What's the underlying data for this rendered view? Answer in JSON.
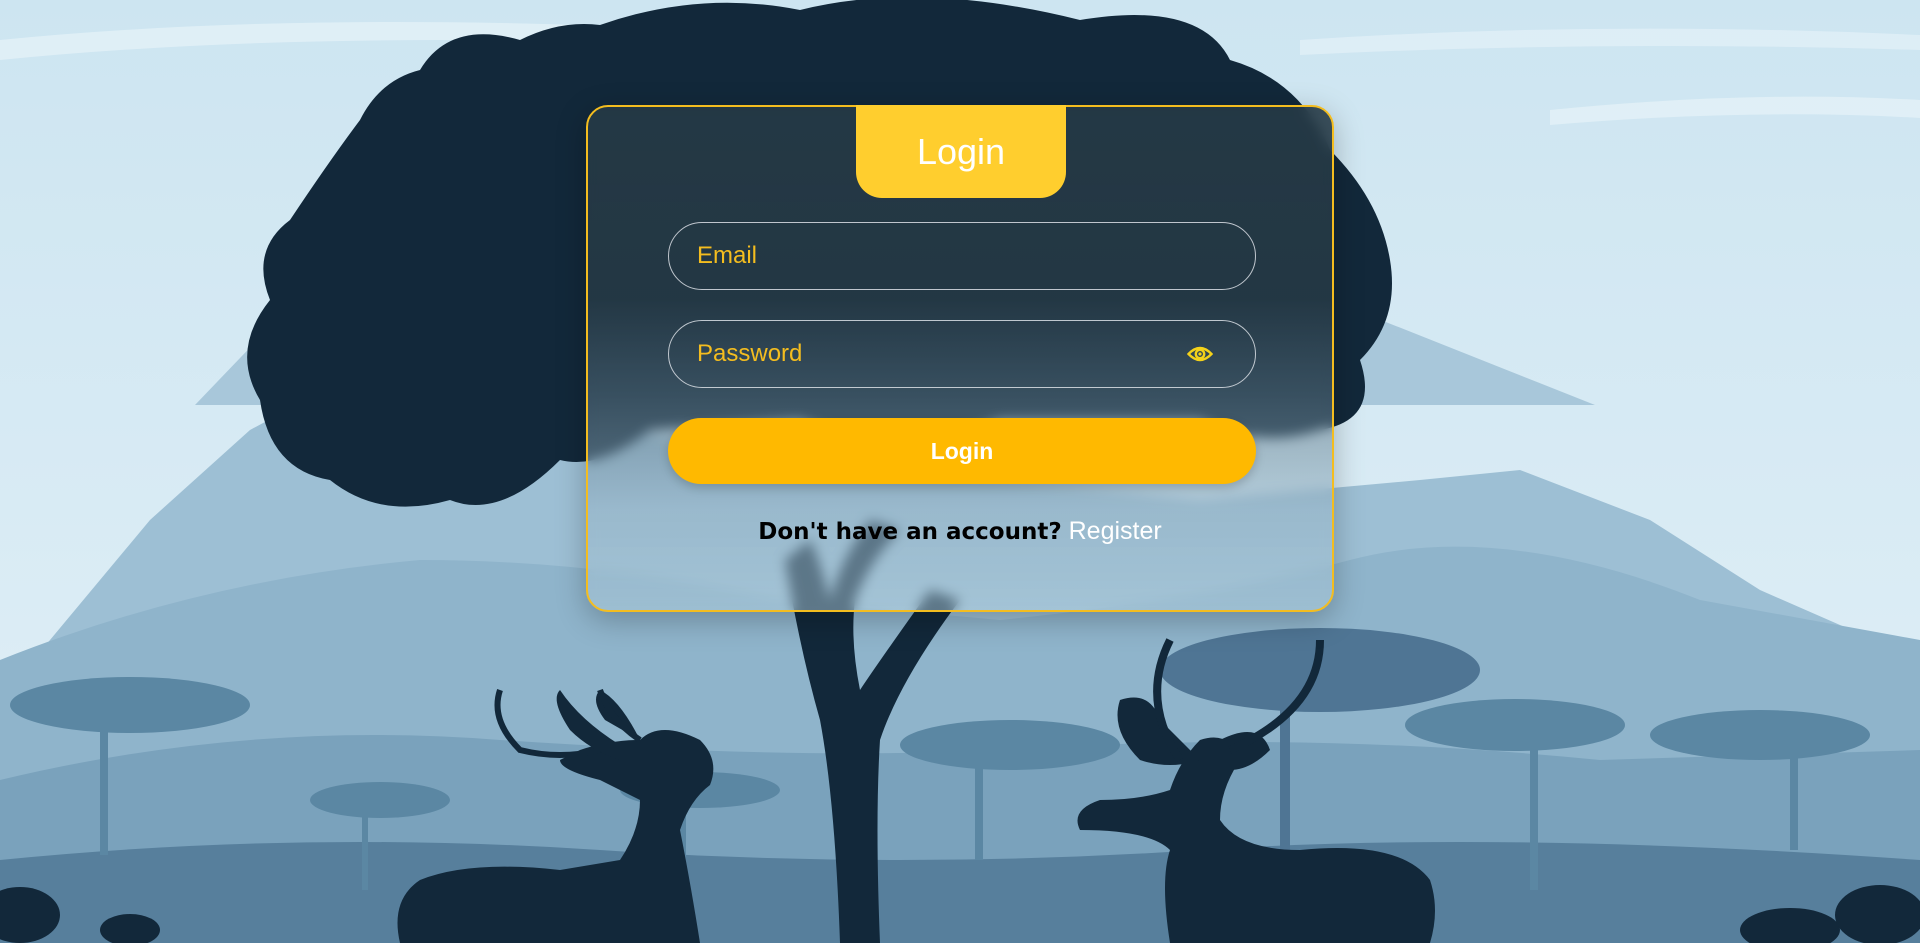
{
  "login": {
    "title": "Login",
    "email_placeholder": "Email",
    "password_placeholder": "Password",
    "submit_label": "Login",
    "register_prompt": "Don't have an account?",
    "register_link": "Register"
  },
  "icons": {
    "password_toggle": "eye-icon"
  },
  "colors": {
    "accent": "#ffce2e",
    "button": "#ffb900",
    "input_text": "#f4bd1f",
    "card_border": "#f4bd1f",
    "sky": "#cfe6f1",
    "silhouette": "#12283a"
  }
}
